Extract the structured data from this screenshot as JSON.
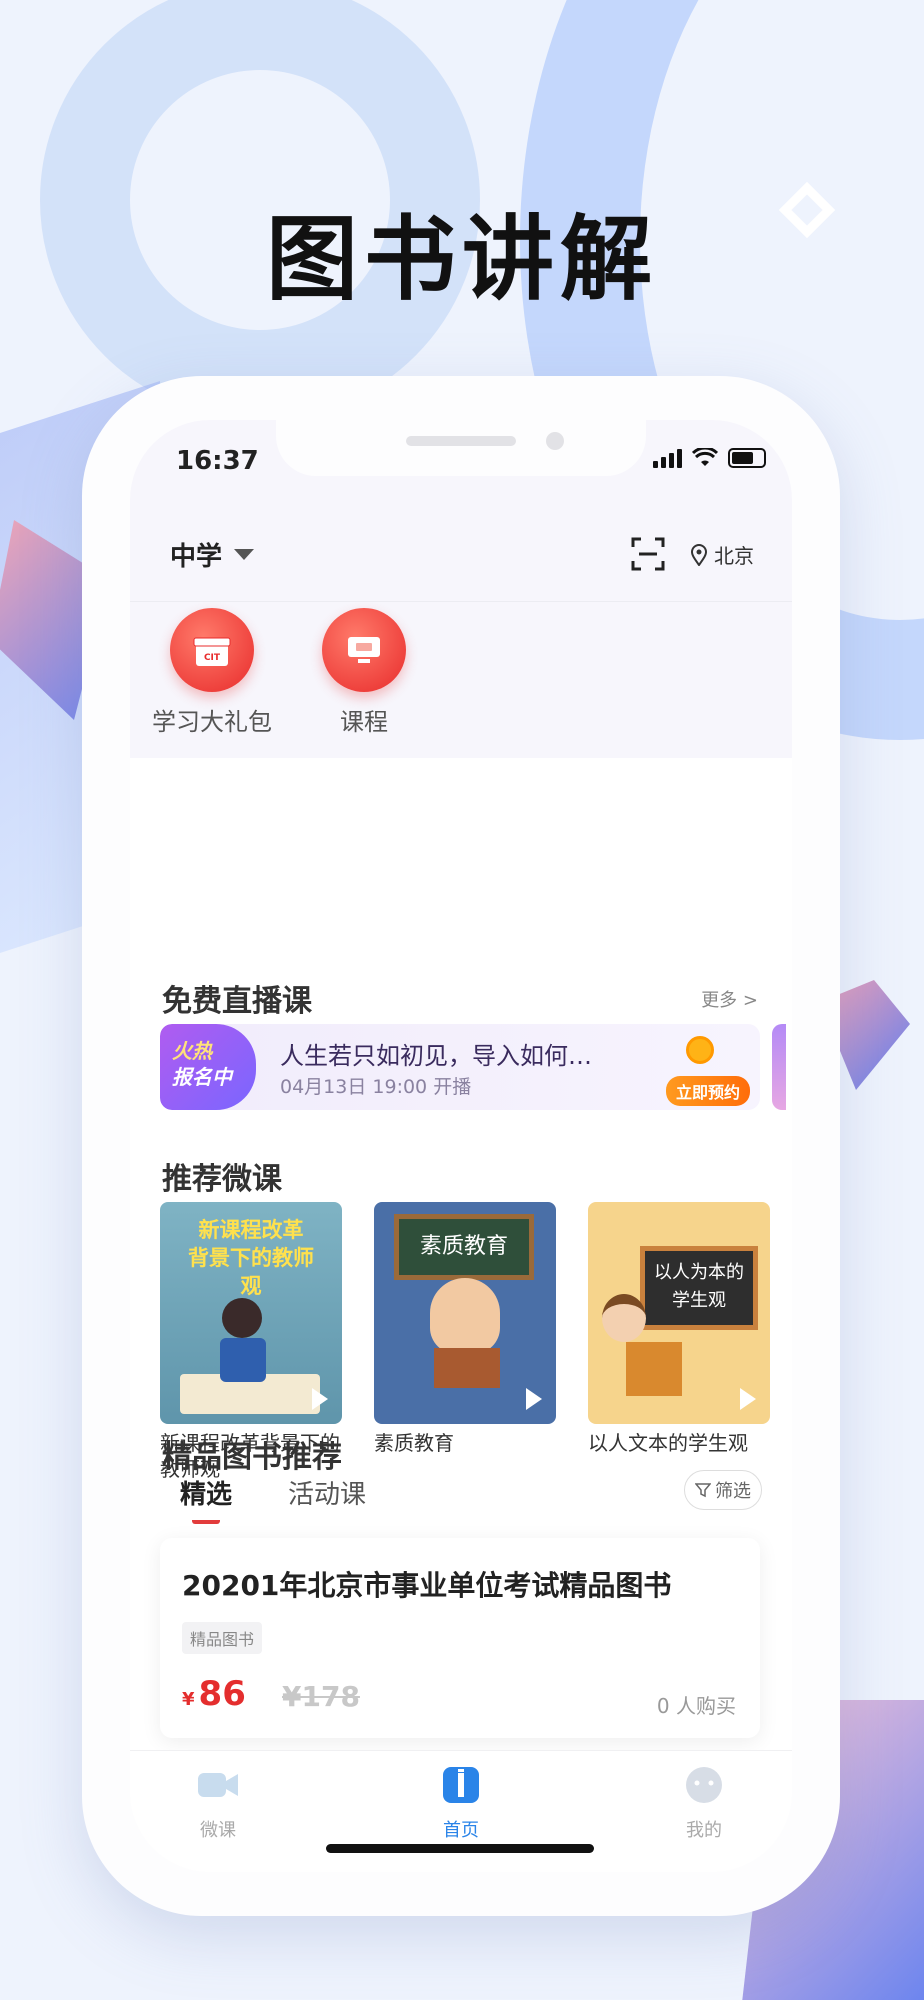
{
  "headline": "图书讲解",
  "status": {
    "time": "16:37"
  },
  "topbar": {
    "level": "中学",
    "location": "北京"
  },
  "quick_links": [
    {
      "label": "学习大礼包",
      "icon": "gift-icon"
    },
    {
      "label": "课程",
      "icon": "course-icon"
    }
  ],
  "live_section": {
    "title": "免费直播课",
    "more": "更多 >",
    "badge_line1": "火热",
    "badge_line2": "报名中",
    "item_title": "人生若只如初见，导入如何…",
    "item_time": "04月13日 19:00 开播",
    "book_button": "立即预约"
  },
  "micro_section": {
    "title": "推荐微课",
    "cards": [
      {
        "title": "新课程改革背景下的教师观",
        "thumb_text": "新课程改革\n背景下的教师观"
      },
      {
        "title": "素质教育",
        "thumb_text": "素质教育"
      },
      {
        "title": "以人文本的学生观",
        "thumb_text": "以人为本的\n学生观"
      }
    ]
  },
  "books_section": {
    "title": "精品图书推荐",
    "tabs": [
      "精选",
      "活动课"
    ],
    "filter": "筛选",
    "book": {
      "title": "20201年北京市事业单位考试精品图书",
      "tag": "精品图书",
      "currency": "¥",
      "price": "86",
      "old_price": "¥178",
      "buyers": "0 人购买"
    }
  },
  "tabbar": [
    {
      "label": "微课",
      "icon": "video-icon",
      "active": false
    },
    {
      "label": "首页",
      "icon": "home-book-icon",
      "active": true
    },
    {
      "label": "我的",
      "icon": "profile-icon",
      "active": false
    }
  ],
  "colors": {
    "accent_red": "#e42e2e",
    "accent_blue": "#2a84e8",
    "live_purple": "#8a63f5"
  }
}
